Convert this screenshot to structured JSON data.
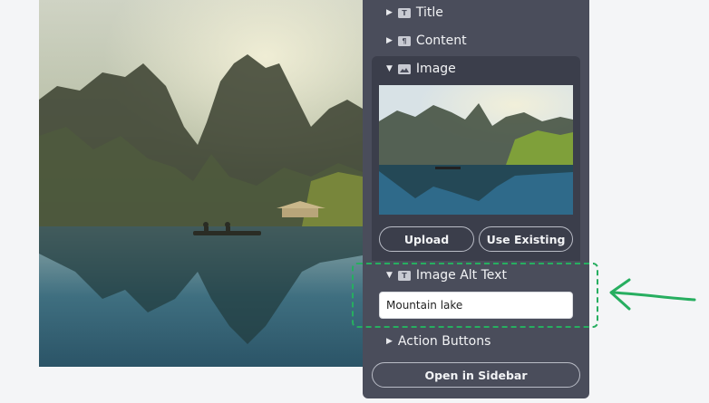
{
  "panel": {
    "sections": {
      "title": {
        "label": "Title",
        "icon": "text-type-icon",
        "icon_glyph": "T"
      },
      "content": {
        "label": "Content",
        "icon": "paragraph-type-icon",
        "icon_glyph": "¶"
      },
      "image": {
        "label": "Image",
        "icon": "image-type-icon"
      },
      "image_alt": {
        "label": "Image Alt Text",
        "icon": "text-type-icon",
        "icon_glyph": "T"
      },
      "action_buttons": {
        "label": "Action Buttons"
      }
    },
    "upload_label": "Upload",
    "use_existing_label": "Use Existing",
    "alt_text_value": "Mountain lake",
    "open_sidebar_label": "Open in Sidebar"
  },
  "colors": {
    "panel_bg": "#4a4d5b",
    "card_bg": "#3b3e4b",
    "highlight": "#27ae60",
    "arrow": "#27ae60"
  }
}
